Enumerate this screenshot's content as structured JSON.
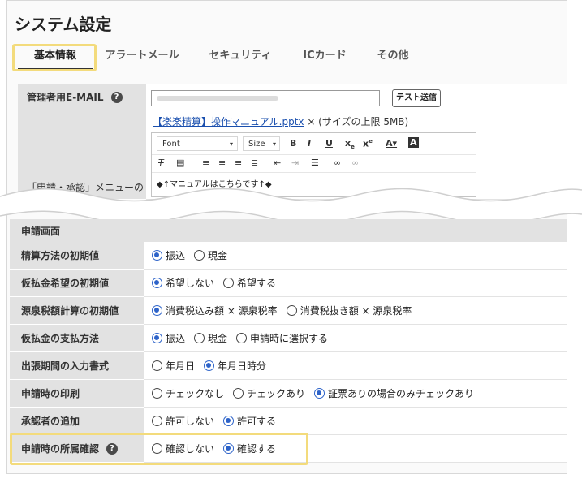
{
  "page_title": "システム設定",
  "tabs": [
    {
      "label": "基本情報",
      "active": true
    },
    {
      "label": "アラートメール",
      "active": false
    },
    {
      "label": "セキュリティ",
      "active": false
    },
    {
      "label": "ICカード",
      "active": false
    },
    {
      "label": "その他",
      "active": false
    }
  ],
  "admin_email": {
    "label": "管理者用E-MAIL",
    "help": "?",
    "test_button": "テスト送信"
  },
  "manual": {
    "label": "「申請・承認」メニューの",
    "file_link": "【楽楽精算】操作マニュアル.pptx",
    "file_suffix": " × (サイズの上限 5MB)",
    "editor": {
      "font": "Font",
      "size": "Size",
      "content": "◆↑マニュアルはこちらです↑◆"
    }
  },
  "section": "申請画面",
  "rows": [
    {
      "label": "精算方法の初期値",
      "options": [
        "振込",
        "現金"
      ],
      "selected": 0
    },
    {
      "label": "仮払金希望の初期値",
      "options": [
        "希望しない",
        "希望する"
      ],
      "selected": 0
    },
    {
      "label": "源泉税額計算の初期値",
      "options": [
        "消費税込み額 × 源泉税率",
        "消費税抜き額 × 源泉税率"
      ],
      "selected": 0
    },
    {
      "label": "仮払金の支払方法",
      "options": [
        "振込",
        "現金",
        "申請時に選択する"
      ],
      "selected": 0
    },
    {
      "label": "出張期間の入力書式",
      "options": [
        "年月日",
        "年月日時分"
      ],
      "selected": 1
    },
    {
      "label": "申請時の印刷",
      "options": [
        "チェックなし",
        "チェックあり",
        "証票ありの場合のみチェックあり"
      ],
      "selected": 2
    },
    {
      "label": "承認者の追加",
      "options": [
        "許可しない",
        "許可する"
      ],
      "selected": 1
    },
    {
      "label": "申請時の所属確認",
      "help": "?",
      "options": [
        "確認しない",
        "確認する"
      ],
      "selected": 1
    }
  ],
  "colors": {
    "accent": "#2d63c9",
    "highlight": "#f3db7c",
    "label_bg": "#e2e2e2"
  }
}
